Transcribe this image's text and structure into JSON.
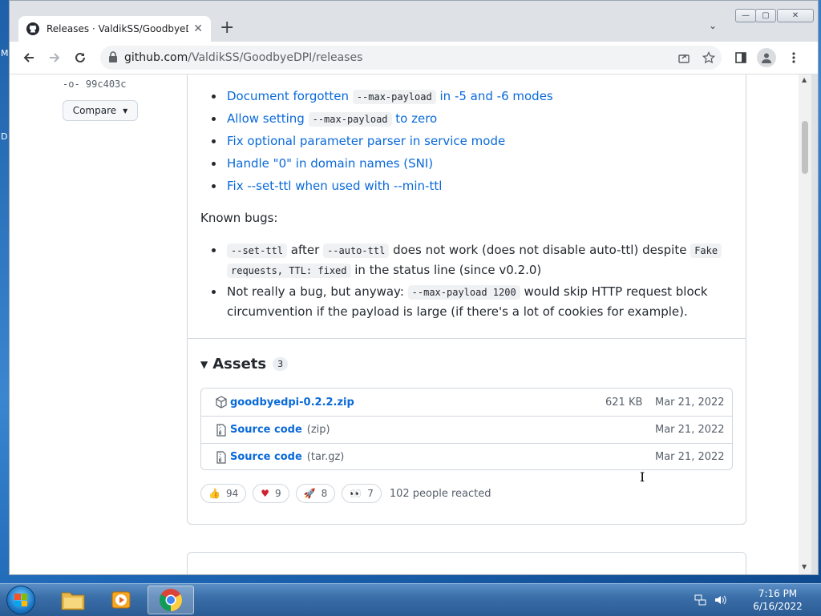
{
  "desktop": {
    "left_letters": [
      "M",
      "D"
    ]
  },
  "browser": {
    "tab": {
      "title": "Releases · ValdikSS/GoodbyeDPI",
      "favicon": "github-icon"
    },
    "controls": {
      "minimize": "—",
      "maximize": "▢",
      "close": "✕"
    },
    "url_host": "github.com",
    "url_path": "/ValdikSS/GoodbyeDPI/releases"
  },
  "sidebar": {
    "commit": "99c403c",
    "compare_label": "Compare"
  },
  "release_notes": {
    "fixes": [
      {
        "parts": [
          "Document forgotten ",
          "--max-payload",
          " in -5 and -6 modes"
        ]
      },
      {
        "parts": [
          "Allow setting ",
          "--max-payload",
          " to zero"
        ]
      },
      {
        "text": "Fix optional parameter parser in service mode"
      },
      {
        "text": "Handle \"0\" in domain names (SNI)"
      },
      {
        "text": "Fix --set-ttl when used with --min-ttl"
      }
    ],
    "known_bugs_heading": "Known bugs:",
    "bug1": {
      "code1": "--set-ttl",
      "t1": " after ",
      "code2": "--auto-ttl",
      "t2": " does not work (does not disable auto-ttl) despite ",
      "code3a": "Fake",
      "code3b": "requests, TTL: fixed",
      "t3": " in the status line (since v0.2.0)"
    },
    "bug2": {
      "t1": "Not really a bug, but anyway: ",
      "code1": "--max-payload 1200",
      "t2": " would skip HTTP request block",
      "t3": "circumvention if the payload is large (if there's a lot of cookies for example)."
    }
  },
  "assets": {
    "title": "Assets",
    "count": "3",
    "items": [
      {
        "name": "goodbyedpi-0.2.2.zip",
        "format": "",
        "size": "621 KB",
        "date": "Mar 21, 2022",
        "icon": "package-icon"
      },
      {
        "name": "Source code",
        "format": "(zip)",
        "size": "",
        "date": "Mar 21, 2022",
        "icon": "file-zip-icon"
      },
      {
        "name": "Source code",
        "format": "(tar.gz)",
        "size": "",
        "date": "Mar 21, 2022",
        "icon": "file-zip-icon"
      }
    ]
  },
  "reactions": {
    "items": [
      {
        "emoji": "👍",
        "count": "94",
        "name": "thumbs-up"
      },
      {
        "emoji": "♥",
        "count": "9",
        "name": "heart"
      },
      {
        "emoji": "🚀",
        "count": "8",
        "name": "rocket"
      },
      {
        "emoji": "👀",
        "count": "7",
        "name": "eyes"
      }
    ],
    "total_text": "102 people reacted"
  },
  "taskbar": {
    "time": "7:16 PM",
    "date": "6/16/2022"
  },
  "colors": {
    "link": "#0969da",
    "text": "#24292f",
    "muted": "#57606a",
    "border": "#d0d7de"
  }
}
